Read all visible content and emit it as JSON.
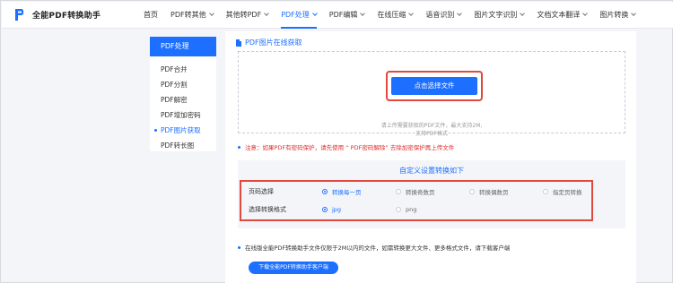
{
  "app": {
    "logo_text": "全能PDF转换助手"
  },
  "nav": {
    "items": [
      {
        "label": "首页"
      },
      {
        "label": "PDF转其他"
      },
      {
        "label": "其他转PDF"
      },
      {
        "label": "PDF处理"
      },
      {
        "label": "PDF编辑"
      },
      {
        "label": "在线压缩"
      },
      {
        "label": "语音识别"
      },
      {
        "label": "图片文字识别"
      },
      {
        "label": "文档文本翻译"
      },
      {
        "label": "图片转换"
      }
    ]
  },
  "sidebar": {
    "title": "PDF处理",
    "items": [
      {
        "label": "PDF合并"
      },
      {
        "label": "PDF分割"
      },
      {
        "label": "PDF解密"
      },
      {
        "label": "PDF增加密码"
      },
      {
        "label": "PDF图片获取"
      },
      {
        "label": "PDF转长图"
      }
    ]
  },
  "main": {
    "title": "PDF图片在线获取",
    "upload": {
      "button_label": "点击选择文件",
      "hint_line1": "请上传需要获取的PDF文件，最大支持2M,",
      "hint_line2": "支持PDF格式"
    },
    "notice": "注意：如果PDF有密码保护，请先使用 “ PDF密码解除” 去除加密保护再上传文件",
    "settings": {
      "title": "自定义设置转换如下",
      "page_label": "页码选择",
      "page_options": [
        {
          "label": "转换每一页",
          "selected": true
        },
        {
          "label": "转换奇数页",
          "selected": false
        },
        {
          "label": "转换偶数页",
          "selected": false
        },
        {
          "label": "指定页转换",
          "selected": false
        }
      ],
      "format_label": "选择转换格式",
      "format_options": [
        {
          "label": "jpg",
          "selected": true
        },
        {
          "label": "png",
          "selected": false
        }
      ]
    },
    "footer_text": "在线版全能PDF转换助手文件仅限于2M以内的文件，如需转换更大文件、更多格式文件，请下载客户端",
    "download_label": "下载全能PDF转换助手客户端"
  },
  "colors": {
    "accent": "#1c6fff",
    "highlight": "#e0493e",
    "warning": "#e02b2b"
  }
}
